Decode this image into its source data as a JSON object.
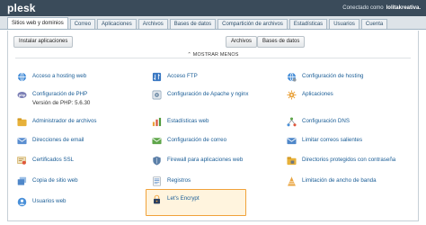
{
  "app": {
    "logo": "plesk"
  },
  "user": {
    "prefix": "Conectado como",
    "name": "lolitakreativa."
  },
  "tabs": [
    "Sitios web y dominios",
    "Correo",
    "Aplicaciones",
    "Archivos",
    "Bases de datos",
    "Compartición de archivos",
    "Estadísticas",
    "Usuarios",
    "Cuenta"
  ],
  "active_tab": "Sitios web y dominios",
  "toolbar": {
    "install_apps": "Instalar aplicaciones",
    "files": "Archivos",
    "databases": "Bases de datos"
  },
  "show_less": "⌃ MOSTRAR MENOS",
  "tools": {
    "col1": [
      {
        "label": "Acceso a hosting web",
        "icon": "hosting-access-icon"
      },
      {
        "label": "Configuración de PHP",
        "sub": "Versión de PHP: 5.6.30",
        "icon": "php-icon"
      },
      {
        "label": "Administrador de archivos",
        "icon": "file-manager-icon"
      },
      {
        "label": "Direcciones de email",
        "icon": "mail-addresses-icon"
      },
      {
        "label": "Certificados SSL",
        "icon": "ssl-certificate-icon"
      },
      {
        "label": "Copia de sitio web",
        "icon": "website-copy-icon"
      },
      {
        "label": "Usuarios web",
        "icon": "web-users-icon"
      }
    ],
    "col2": [
      {
        "label": "Acceso FTP",
        "icon": "ftp-access-icon"
      },
      {
        "label": "Configuración de Apache y nginx",
        "icon": "apache-nginx-icon"
      },
      {
        "label": "Estadísticas web",
        "icon": "web-statistics-icon"
      },
      {
        "label": "Configuración de correo",
        "icon": "mail-settings-icon"
      },
      {
        "label": "Firewall para aplicaciones web",
        "icon": "firewall-icon"
      },
      {
        "label": "Registros",
        "icon": "logs-icon"
      },
      {
        "label": "Let's Encrypt",
        "icon": "lets-encrypt-icon"
      }
    ],
    "col3": [
      {
        "label": "Configuración de hosting",
        "icon": "hosting-settings-icon"
      },
      {
        "label": "Aplicaciones",
        "icon": "applications-icon"
      },
      {
        "label": "Configuración DNS",
        "icon": "dns-settings-icon"
      },
      {
        "label": "Limitar correos salientes",
        "icon": "outgoing-mail-limit-icon"
      },
      {
        "label": "Directorios protegidos con contraseña",
        "icon": "protected-directories-icon"
      },
      {
        "label": "Limitación de ancho de banda",
        "icon": "bandwidth-limit-icon"
      }
    ]
  },
  "colors": {
    "header": "#3a4b5a",
    "link": "#1a5d96",
    "highlight_border": "#f0a23a",
    "highlight_bg": "#fff4de"
  }
}
